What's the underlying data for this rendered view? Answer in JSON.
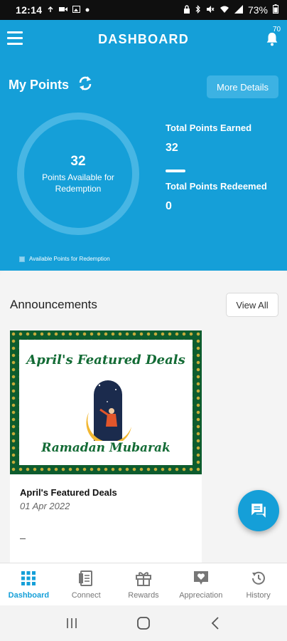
{
  "status_bar": {
    "time": "12:14",
    "battery": "73%",
    "left_icons": [
      "voicemail-icon",
      "video-icon",
      "image-icon",
      "dot-icon"
    ],
    "right_icons": [
      "lock-icon",
      "bluetooth-icon",
      "mute-icon",
      "wifi-icon",
      "signal-icon",
      "battery-icon"
    ]
  },
  "header": {
    "title": "DASHBOARD",
    "notification_count": "70",
    "menu_icon": "hamburger-icon",
    "bell_icon": "bell-icon"
  },
  "points": {
    "title": "My Points",
    "more_details_label": "More Details",
    "available_value": "32",
    "available_label": "Points Available for Redemption",
    "total_earned_label": "Total Points Earned",
    "total_earned_value": "32",
    "total_redeemed_label": "Total Points Redeemed",
    "total_redeemed_value": "0",
    "legend_label": "Available Points for Redemption",
    "colors": {
      "primary": "#159fd8",
      "ring": "#47b6e4"
    }
  },
  "announcements": {
    "title": "Announcements",
    "view_all_label": "View All",
    "items": [
      {
        "banner_heading": "April's Featured Deals",
        "banner_footer": "Ramadan Mubarak",
        "title": "April's Featured Deals",
        "date": "01 Apr 2022"
      }
    ]
  },
  "fab": {
    "icon": "chat-icon"
  },
  "bottom_nav": {
    "items": [
      {
        "label": "Dashboard",
        "icon": "grid-icon",
        "active": true
      },
      {
        "label": "Connect",
        "icon": "document-icon",
        "active": false
      },
      {
        "label": "Rewards",
        "icon": "gift-icon",
        "active": false
      },
      {
        "label": "Appreciation",
        "icon": "heart-message-icon",
        "active": false
      },
      {
        "label": "History",
        "icon": "history-icon",
        "active": false
      }
    ]
  },
  "system_nav": {
    "icons": [
      "recents-icon",
      "home-icon",
      "back-icon"
    ]
  }
}
